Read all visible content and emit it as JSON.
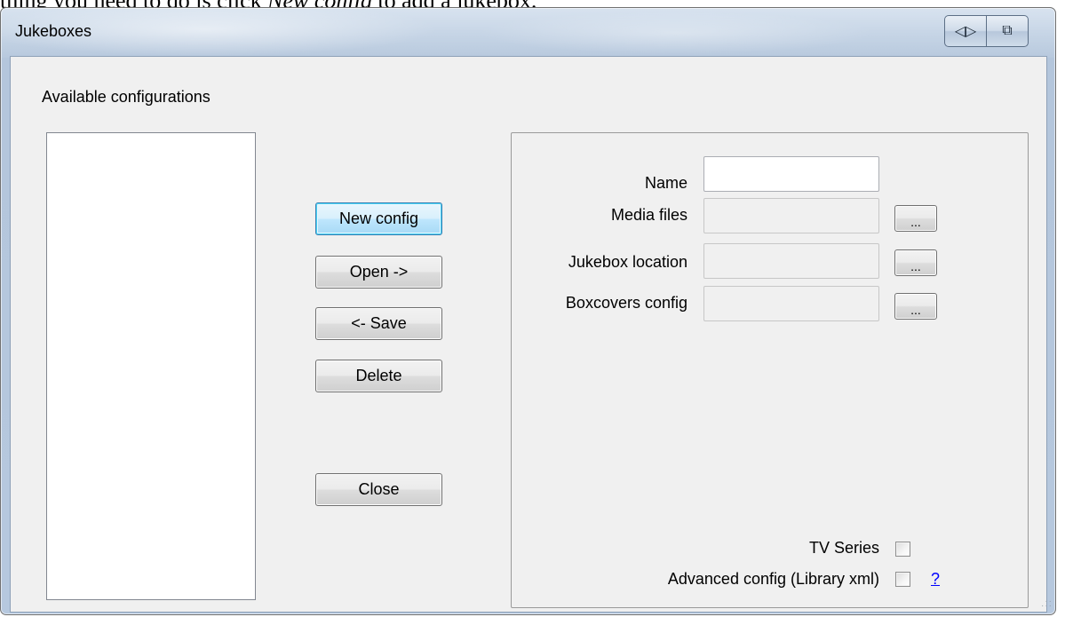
{
  "caption": {
    "prefix": "thing you need to do is click ",
    "emphasis": "New config",
    "suffix": " to add a jukebox."
  },
  "window": {
    "title": "Jukeboxes",
    "caption_buttons": [
      {
        "name": "aero-peek-icon",
        "glyph": "◁▷"
      },
      {
        "name": "switch-window-icon",
        "glyph": "⧉"
      }
    ]
  },
  "left": {
    "available_label": "Available configurations",
    "configurations": []
  },
  "actions": {
    "new_config": "New config",
    "open": "Open ->",
    "save": "<- Save",
    "delete": "Delete",
    "close": "Close"
  },
  "form": {
    "name_label": "Name",
    "name_value": "",
    "media_label": "Media files",
    "media_value": "",
    "jukebox_label": "Jukebox location",
    "jukebox_value": "",
    "boxcovers_label": "Boxcovers config",
    "boxcovers_value": "",
    "browse_label": "...",
    "tv_series_label": "TV Series",
    "tv_series_checked": false,
    "advanced_label": "Advanced config (Library xml)",
    "advanced_checked": false,
    "help_link": "?"
  }
}
